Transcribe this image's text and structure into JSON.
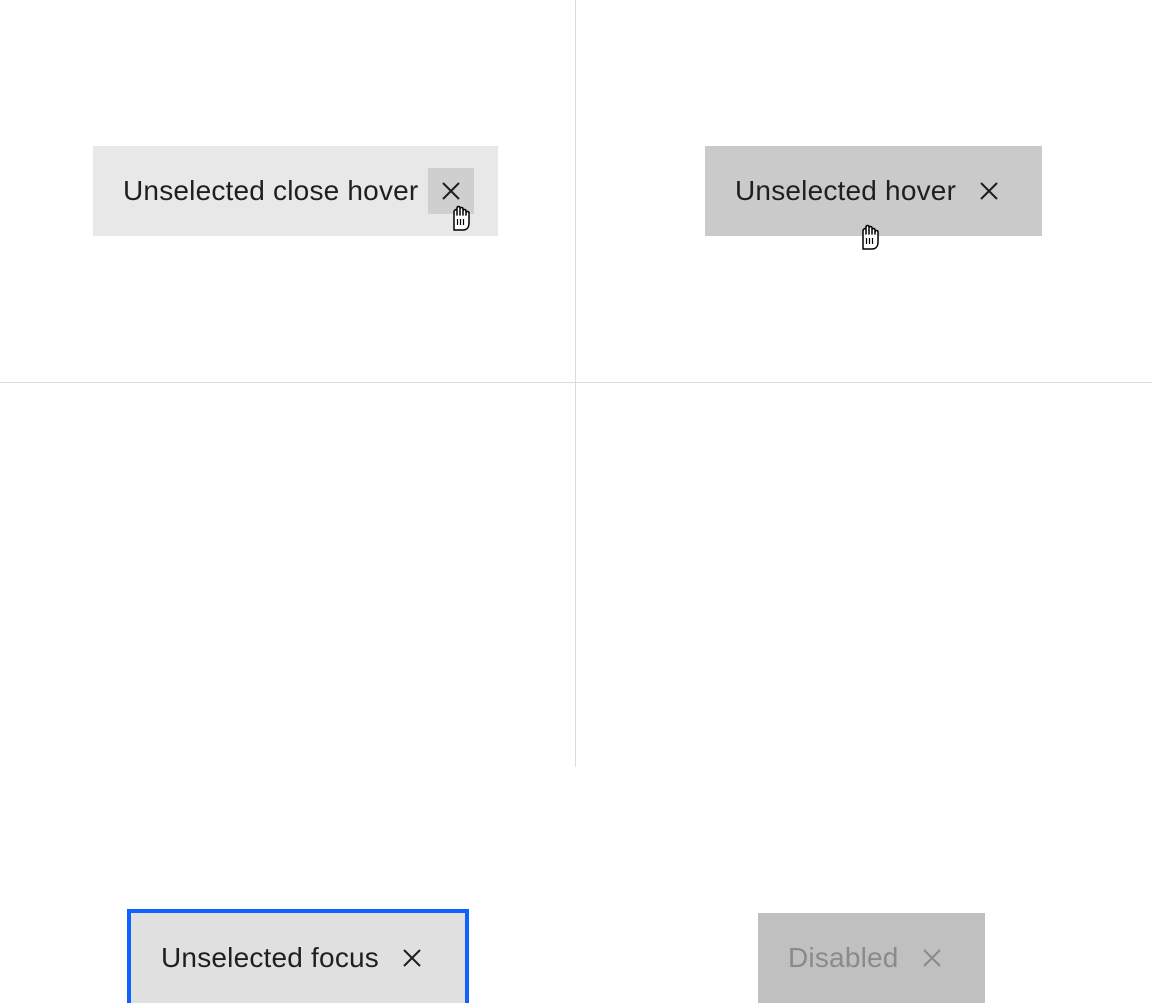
{
  "tags": {
    "closeHover": {
      "label": "Unselected close hover"
    },
    "hover": {
      "label": "Unselected hover"
    },
    "focus": {
      "label": "Unselected focus"
    },
    "disabled": {
      "label": "Disabled"
    }
  }
}
